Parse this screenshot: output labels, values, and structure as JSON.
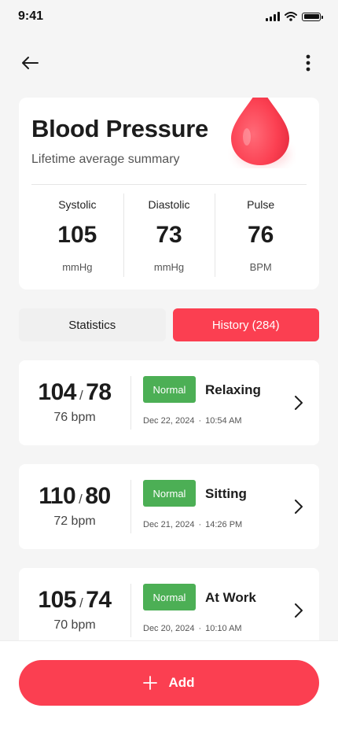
{
  "status_bar": {
    "time": "9:41"
  },
  "colors": {
    "accent": "#fb3f51",
    "normal_badge": "#4caf55"
  },
  "header": {
    "back_icon": "arrow-left-icon",
    "menu_icon": "more-vertical-icon"
  },
  "summary": {
    "title": "Blood Pressure",
    "subtitle": "Lifetime average summary",
    "metrics": [
      {
        "label": "Systolic",
        "value": "105",
        "unit": "mmHg"
      },
      {
        "label": "Diastolic",
        "value": "73",
        "unit": "mmHg"
      },
      {
        "label": "Pulse",
        "value": "76",
        "unit": "BPM"
      }
    ]
  },
  "tabs": [
    {
      "label": "Statistics",
      "active": false
    },
    {
      "label": "History (284)",
      "active": true
    }
  ],
  "records": [
    {
      "systolic": "104",
      "separator": "/",
      "diastolic": "78",
      "pulse": "76 bpm",
      "status": "Normal",
      "activity": "Relaxing",
      "date": "Dec 22, 2024",
      "dot": "·",
      "time": "10:54 AM"
    },
    {
      "systolic": "110",
      "separator": "/",
      "diastolic": "80",
      "pulse": "72 bpm",
      "status": "Normal",
      "activity": "Sitting",
      "date": "Dec 21, 2024",
      "dot": "·",
      "time": "14:26 PM"
    },
    {
      "systolic": "105",
      "separator": "/",
      "diastolic": "74",
      "pulse": "70 bpm",
      "status": "Normal",
      "activity": "At Work",
      "date": "Dec 20, 2024",
      "dot": "·",
      "time": "10:10 AM"
    }
  ],
  "add_button": {
    "label": "Add",
    "icon": "plus-icon"
  }
}
